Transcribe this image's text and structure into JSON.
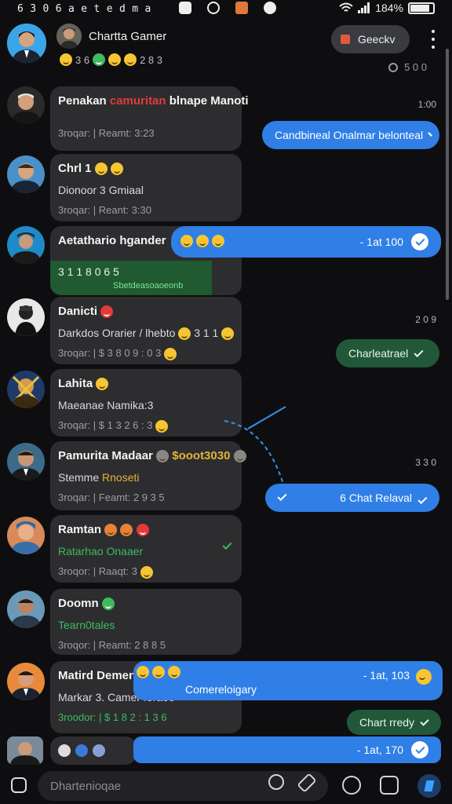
{
  "status_bar": {
    "left_text": "6 3 0 6 a e t e d m a",
    "battery_text": "184%"
  },
  "header": {
    "title": "Chartta Gamer",
    "subtitle_count": "2 8 3",
    "subtitle_prefix": "3 6",
    "pill_label": "Geeckv",
    "meta_time": "5 0 0"
  },
  "chats": [
    {
      "name": "Penakan",
      "name_highlight": "camuritan",
      "name_rest": "blnape Manoti",
      "line2": "",
      "meta": "3roqar: | Reamt: 3:23",
      "time": "1:00",
      "bubble": {
        "text": "Candbineal Onalmar belonteal",
        "style": "blue",
        "tick": true
      }
    },
    {
      "name": "Chrl 1",
      "line2": "Dionoor 3 Gmiaal",
      "meta": "3roqar: | Reant: 3:30"
    },
    {
      "name": "Aetathario hgander",
      "line2": "3 1 1 8 0 6 5",
      "meta": "Sbetdeasoaoeonb",
      "bubble": {
        "text": "- 1at 100",
        "style": "blue",
        "tick": true
      }
    },
    {
      "name": "Danicti",
      "line2": "Darkdos Orarier / lhebto",
      "line2_suffix": "3 1 1",
      "meta": "3roqar: | $ 3 8 0 9 : 0 3",
      "time": "2 0 9",
      "bubble": {
        "text": "Charleatrael",
        "style": "dgreen",
        "tick": true
      }
    },
    {
      "name": "Lahita",
      "line2": "Maeanae Namika:3",
      "meta": "3roqar: | $ 1 3 2 6 : 3"
    },
    {
      "name": "Pamurita Madaar",
      "name_suffix": "$ooot3030",
      "line2": "Stemme",
      "line2_suffix": "Rnoseti",
      "meta": "3roqar: | Feamt: 2 9 3 5",
      "time": "3 3 0",
      "bubble": {
        "text": "6 Chat Relaval",
        "style": "blue",
        "tick": true
      }
    },
    {
      "name": "Ramtan",
      "line2": "Ratarhao Onaaer",
      "meta": "3roqor: | Raaqt: 3"
    },
    {
      "name": "Doomn",
      "line2": "Tearn0tales",
      "meta": "3roqor: | Reamt: 2 8 8 5"
    },
    {
      "name": "Matird Dement",
      "line2": "Markar 3. Camer foraoo",
      "meta": "3roodor: | $ 1 8 2 : 1 3 6",
      "bubble": {
        "text": "Comereloigary",
        "style": "blue",
        "tick": false
      },
      "bubble_right": {
        "text": "- 1at, 103",
        "style": "blue"
      },
      "bubble2": {
        "text": "Chart rredy",
        "style": "dgreen",
        "tick": true
      }
    },
    {
      "name": "",
      "bubble": {
        "text": "- 1at, 170",
        "style": "blue",
        "tick": true
      }
    }
  ],
  "input": {
    "placeholder": "Dhartenioqae"
  },
  "colors": {
    "background": "#0e0e10",
    "card": "#2d2d30",
    "bubble_blue": "#2f7fe6",
    "bubble_green": "#22583a",
    "accent_green": "#3dbb5d"
  }
}
